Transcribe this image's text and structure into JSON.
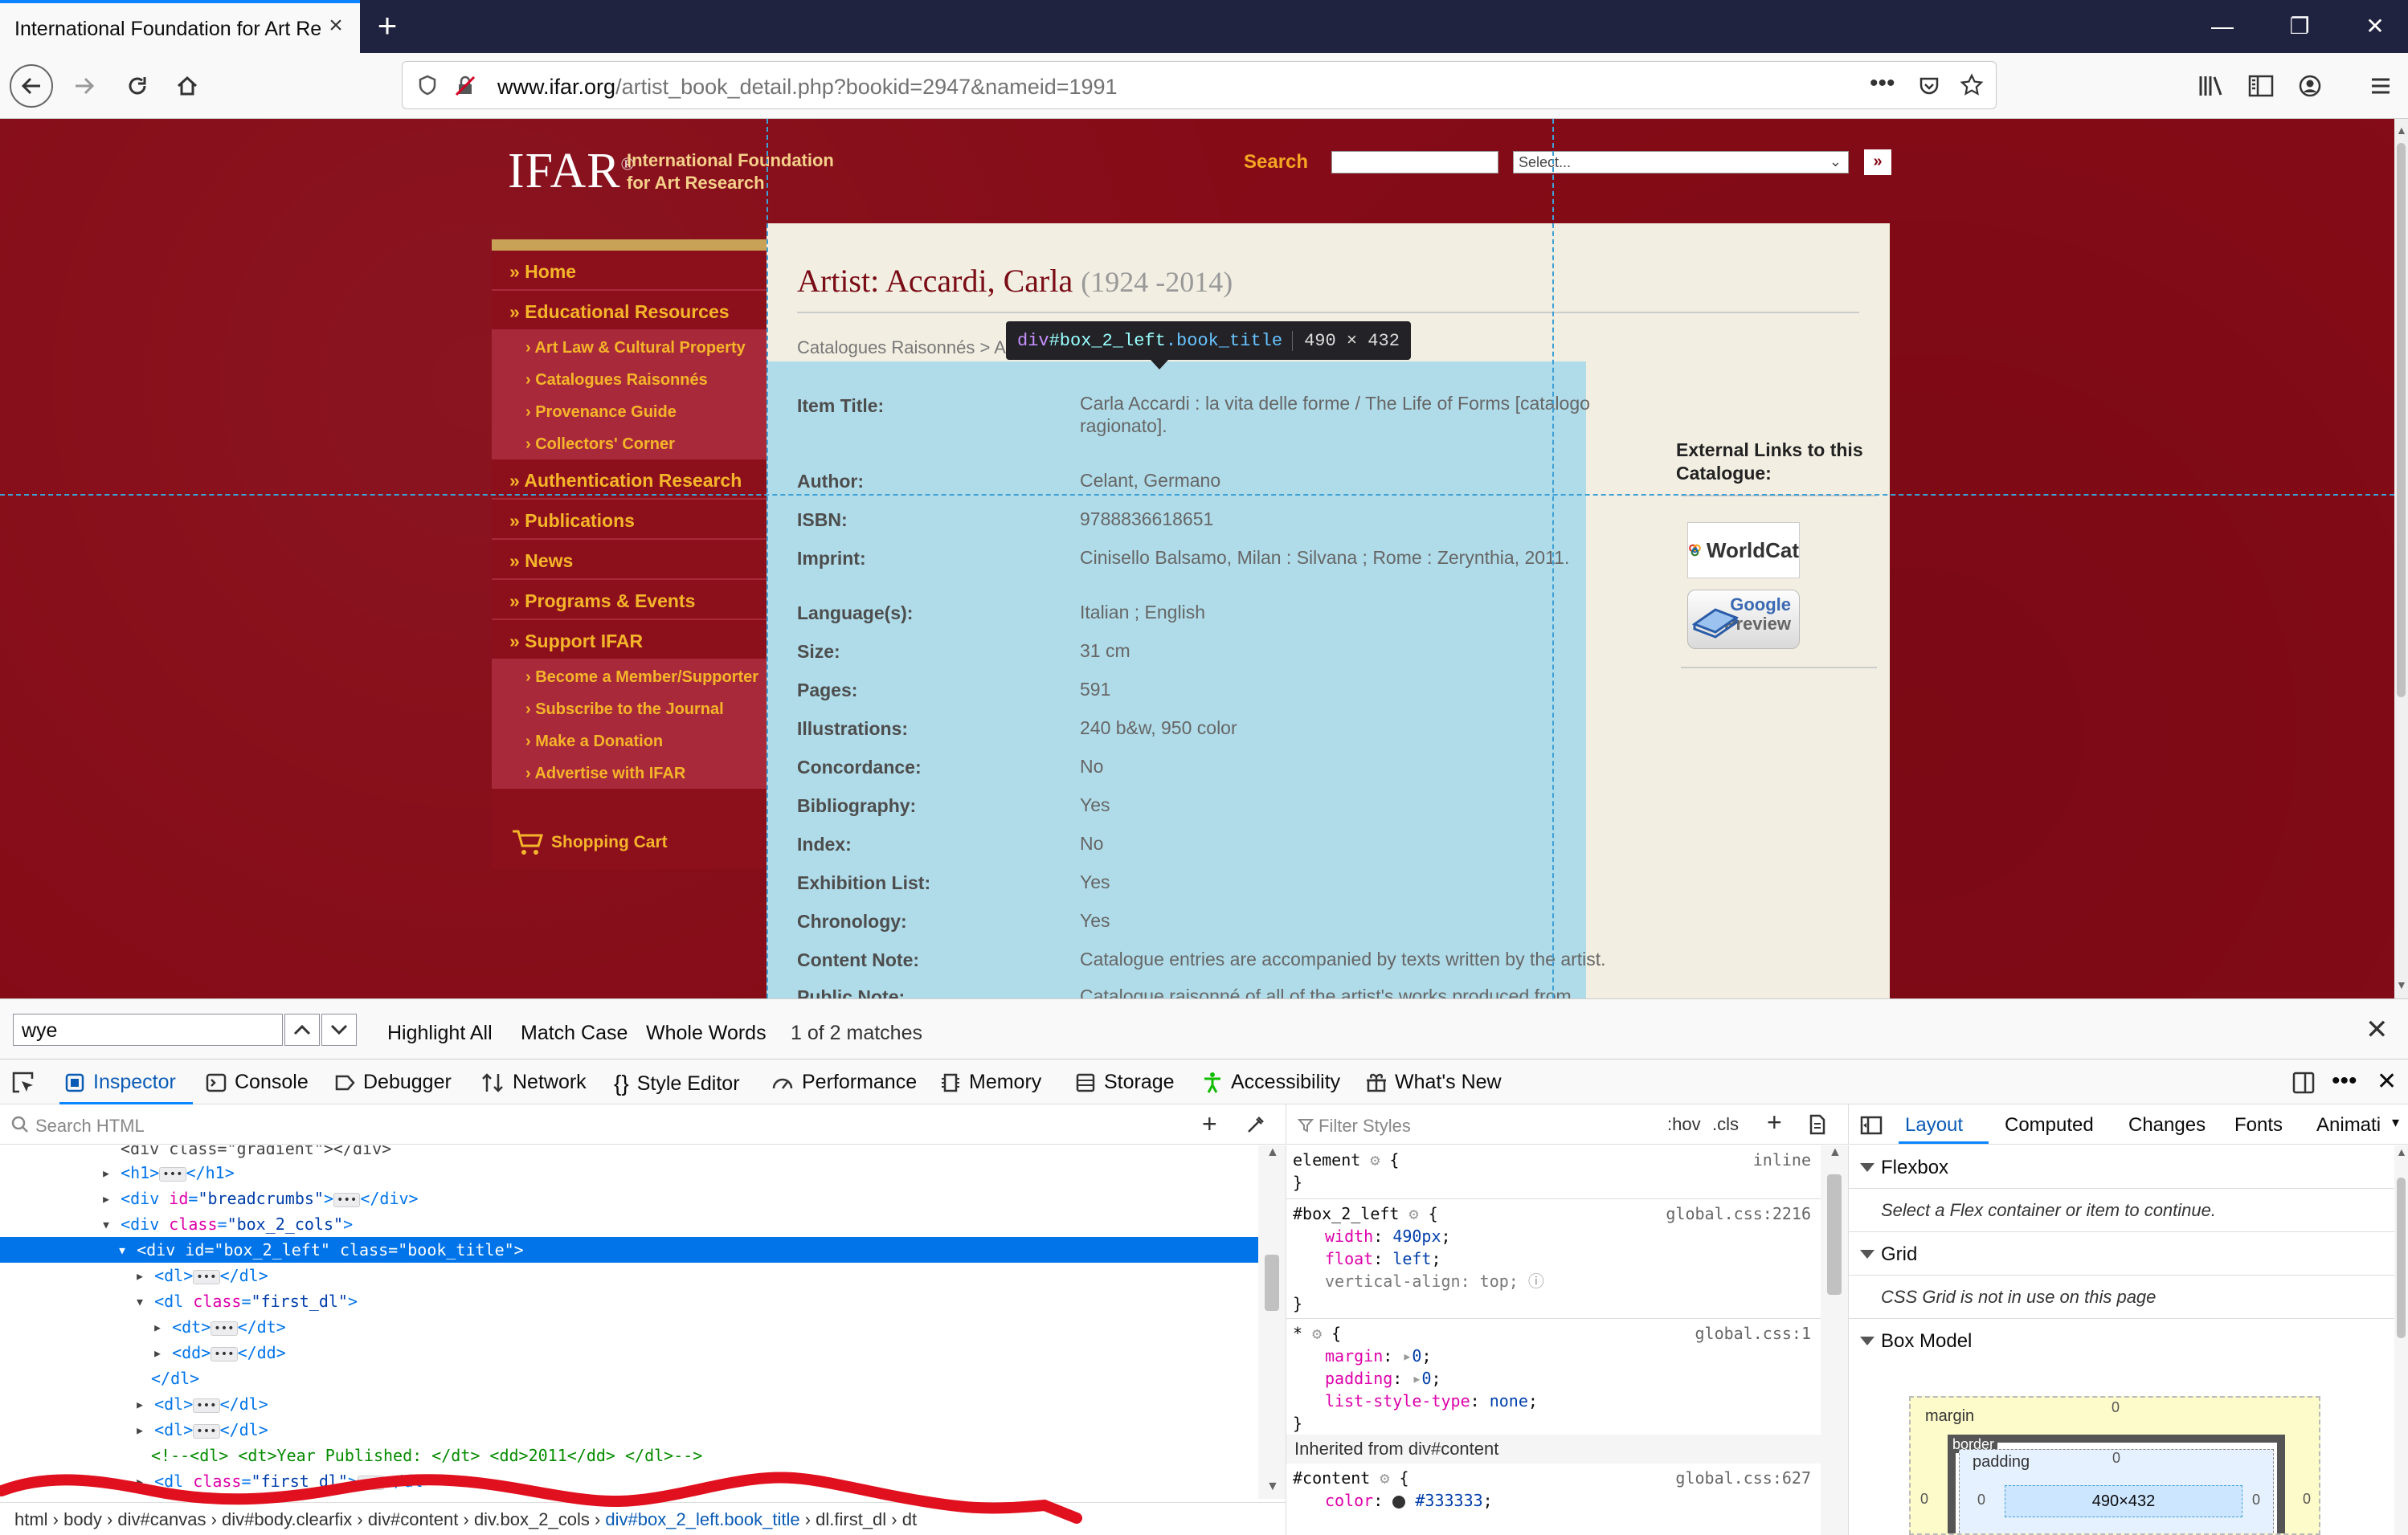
{
  "browser": {
    "tab_title": "International Foundation for Art Re",
    "url_domain": "www.ifar.org",
    "url_path": "/artist_book_detail.php?bookid=2947&nameid=1991"
  },
  "site": {
    "logo": "IFAR",
    "logo_registered": "®",
    "logo_line1": "International Foundation",
    "logo_line2": "for Art Research",
    "search_label": "Search",
    "search_select": "Select...",
    "search_go": "»"
  },
  "nav": {
    "items": [
      {
        "label": "» Home"
      },
      {
        "label": "» Educational Resources"
      },
      {
        "label": "› Art Law & Cultural Property"
      },
      {
        "label": "› Catalogues Raisonnés"
      },
      {
        "label": "› Provenance Guide"
      },
      {
        "label": "› Collectors' Corner"
      },
      {
        "label": "» Authentication Research"
      },
      {
        "label": "» Publications"
      },
      {
        "label": "» News"
      },
      {
        "label": "» Programs & Events"
      },
      {
        "label": "» Support IFAR"
      },
      {
        "label": "› Become a Member/Supporter"
      },
      {
        "label": "› Subscribe to the Journal"
      },
      {
        "label": "› Make a Donation"
      },
      {
        "label": "› Advertise with IFAR"
      }
    ],
    "cart": "Shopping Cart"
  },
  "content": {
    "title": "Artist: Accardi, Carla",
    "dates": "(1924 -2014)",
    "breadcrumb": "Catalogues Raisonnés > A",
    "fields": [
      {
        "label": "Item Title:",
        "value": "Carla Accardi : la vita delle forme / The Life of Forms [catalogo ragionato]."
      },
      {
        "label": "Author:",
        "value": "Celant, Germano"
      },
      {
        "label": "ISBN:",
        "value": "9788836618651"
      },
      {
        "label": "Imprint:",
        "value": "Cinisello Balsamo, Milan : Silvana ; Rome : Zerynthia, 2011."
      },
      {
        "label": "Language(s):",
        "value": "Italian ;  English"
      },
      {
        "label": "Size:",
        "value": "31 cm"
      },
      {
        "label": "Pages:",
        "value": "591"
      },
      {
        "label": "Illustrations:",
        "value": "240 b&w, 950 color"
      },
      {
        "label": "Concordance:",
        "value": "No"
      },
      {
        "label": "Bibliography:",
        "value": "Yes"
      },
      {
        "label": "Index:",
        "value": "No"
      },
      {
        "label": "Exhibition List:",
        "value": "Yes"
      },
      {
        "label": "Chronology:",
        "value": "Yes"
      },
      {
        "label": "Content Note:",
        "value": "Catalogue entries are accompanied by texts written by the artist."
      },
      {
        "label": "Public Note:",
        "value": "Catalogue raisonné of all of the artist's works produced from"
      }
    ],
    "external_title": "External Links to this Catalogue:",
    "worldcat": "WorldCat",
    "google1": "Google",
    "google2": "Preview"
  },
  "inspector_overlay": {
    "tag": "div",
    "id": "#box_2_left",
    "cls": ".book_title",
    "size": "490 × 432"
  },
  "findbar": {
    "query": "wye",
    "highlight_all": "Highlight All",
    "match_case": "Match Case",
    "whole_words": "Whole Words",
    "status": "1 of 2 matches"
  },
  "devtools": {
    "tabs": [
      "Inspector",
      "Console",
      "Debugger",
      "Network",
      "Style Editor",
      "Performance",
      "Memory",
      "Storage",
      "Accessibility",
      "What's New"
    ],
    "search_html": "Search HTML",
    "filter_styles": "Filter Styles",
    "hov": ":hov",
    "cls": ".cls",
    "layout_tabs": [
      "Layout",
      "Computed",
      "Changes",
      "Fonts",
      "Animati"
    ],
    "flexbox": "Flexbox",
    "flexbox_msg": "Select a Flex container or item to continue.",
    "grid": "Grid",
    "grid_msg": "CSS Grid is not in use on this page",
    "boxmodel": "Box Model",
    "bm_margin": "margin",
    "bm_border": "border",
    "bm_padding": "padding",
    "bm_size": "490×432",
    "bm_zero": "0",
    "inherited": "Inherited from div#content",
    "breadcrumbs": [
      "html",
      "body",
      "div#canvas",
      "div#body.clearfix",
      "div#content",
      "div.box_2_cols",
      "div#box_2_left.book_title",
      "dl.first_dl",
      "dt"
    ]
  }
}
